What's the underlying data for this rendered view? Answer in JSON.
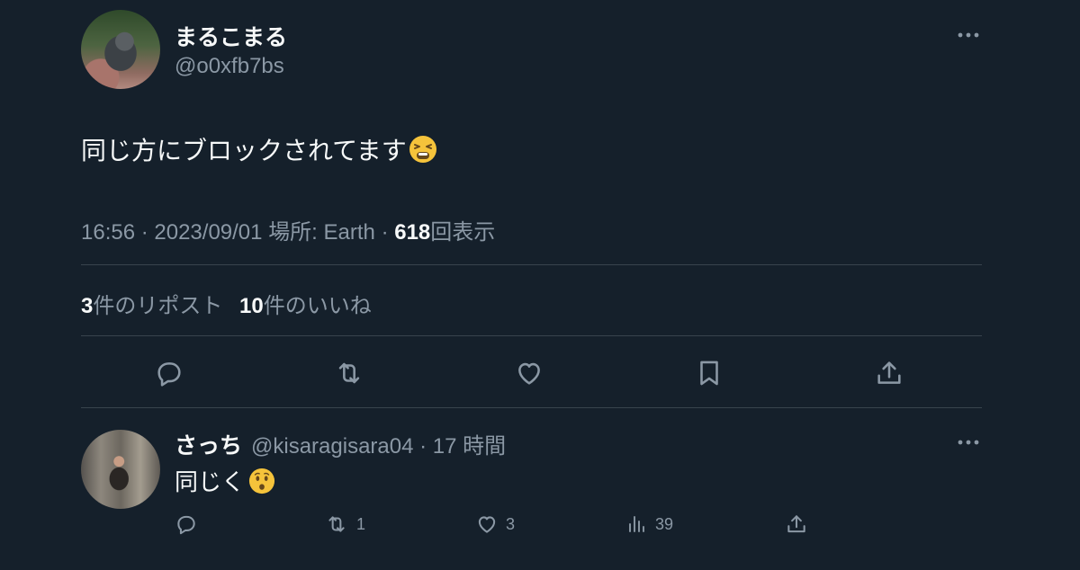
{
  "tweet": {
    "display_name": "まるこまる",
    "handle": "@o0xfb7bs",
    "text": "同じ方にブロックされてます",
    "emoji": "tired-face-emoji",
    "time": "16:56 · 2023/09/01",
    "location_label": "場所: Earth",
    "separator": "·",
    "views_count": "618",
    "views_label": "回表示",
    "reposts_count": "3",
    "reposts_label": "件のリポスト",
    "likes_count": "10",
    "likes_label": "件のいいね"
  },
  "actions": [
    "reply-icon",
    "repost-icon",
    "like-icon",
    "bookmark-icon",
    "share-icon"
  ],
  "reply": {
    "display_name": "さっち",
    "handle_time": "@kisaragisara04 · 17 時間",
    "text": "同じく",
    "emoji": "hushed-face-emoji",
    "repost_count": "1",
    "like_count": "3",
    "views_count": "39"
  },
  "colors": {
    "background": "#15202b",
    "text_primary": "#f7f9f9",
    "text_secondary": "#8b98a5",
    "divider": "#38444d"
  }
}
